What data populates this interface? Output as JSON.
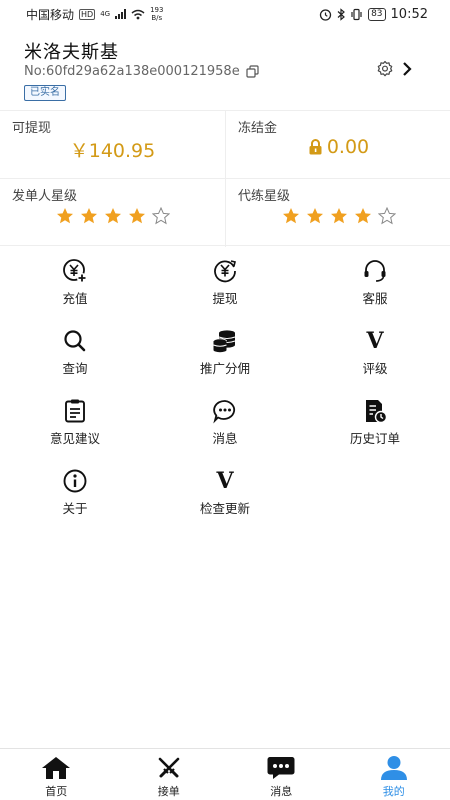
{
  "status_bar": {
    "carrier": "中国移动",
    "hd": "HD",
    "net": "4G",
    "speed_value": "193",
    "speed_unit": "B/s",
    "battery": "83",
    "time": "10:52"
  },
  "profile": {
    "name": "米洛夫斯基",
    "id": "No:60fd29a62a138e000121958e",
    "badge": "已实名"
  },
  "stats": {
    "withdrawable_label": "可提现",
    "withdrawable_value": "￥140.95",
    "frozen_label": "冻结金",
    "frozen_value": "0.00",
    "publisher_rating_label": "发单人星级",
    "publisher_rating": 4,
    "booster_rating_label": "代练星级",
    "booster_rating": 4,
    "rating_max": 5,
    "accent_color": "#d39a16",
    "star_color": "#f0a020"
  },
  "menu": [
    {
      "label": "充值",
      "icon": "recharge-icon"
    },
    {
      "label": "提现",
      "icon": "withdraw-icon"
    },
    {
      "label": "客服",
      "icon": "headset-icon"
    },
    {
      "label": "查询",
      "icon": "search-icon"
    },
    {
      "label": "推广分佣",
      "icon": "coins-icon"
    },
    {
      "label": "评级",
      "icon": "v-icon"
    },
    {
      "label": "意见建议",
      "icon": "clipboard-icon"
    },
    {
      "label": "消息",
      "icon": "chat-icon"
    },
    {
      "label": "历史订单",
      "icon": "history-order-icon"
    },
    {
      "label": "关于",
      "icon": "info-icon"
    },
    {
      "label": "检查更新",
      "icon": "v-icon"
    }
  ],
  "tabs": [
    {
      "label": "首页",
      "icon": "home-icon"
    },
    {
      "label": "接单",
      "icon": "swords-icon"
    },
    {
      "label": "消息",
      "icon": "message-icon"
    },
    {
      "label": "我的",
      "icon": "user-icon",
      "active": true
    }
  ],
  "colors": {
    "tab_active": "#2f8fe6"
  }
}
